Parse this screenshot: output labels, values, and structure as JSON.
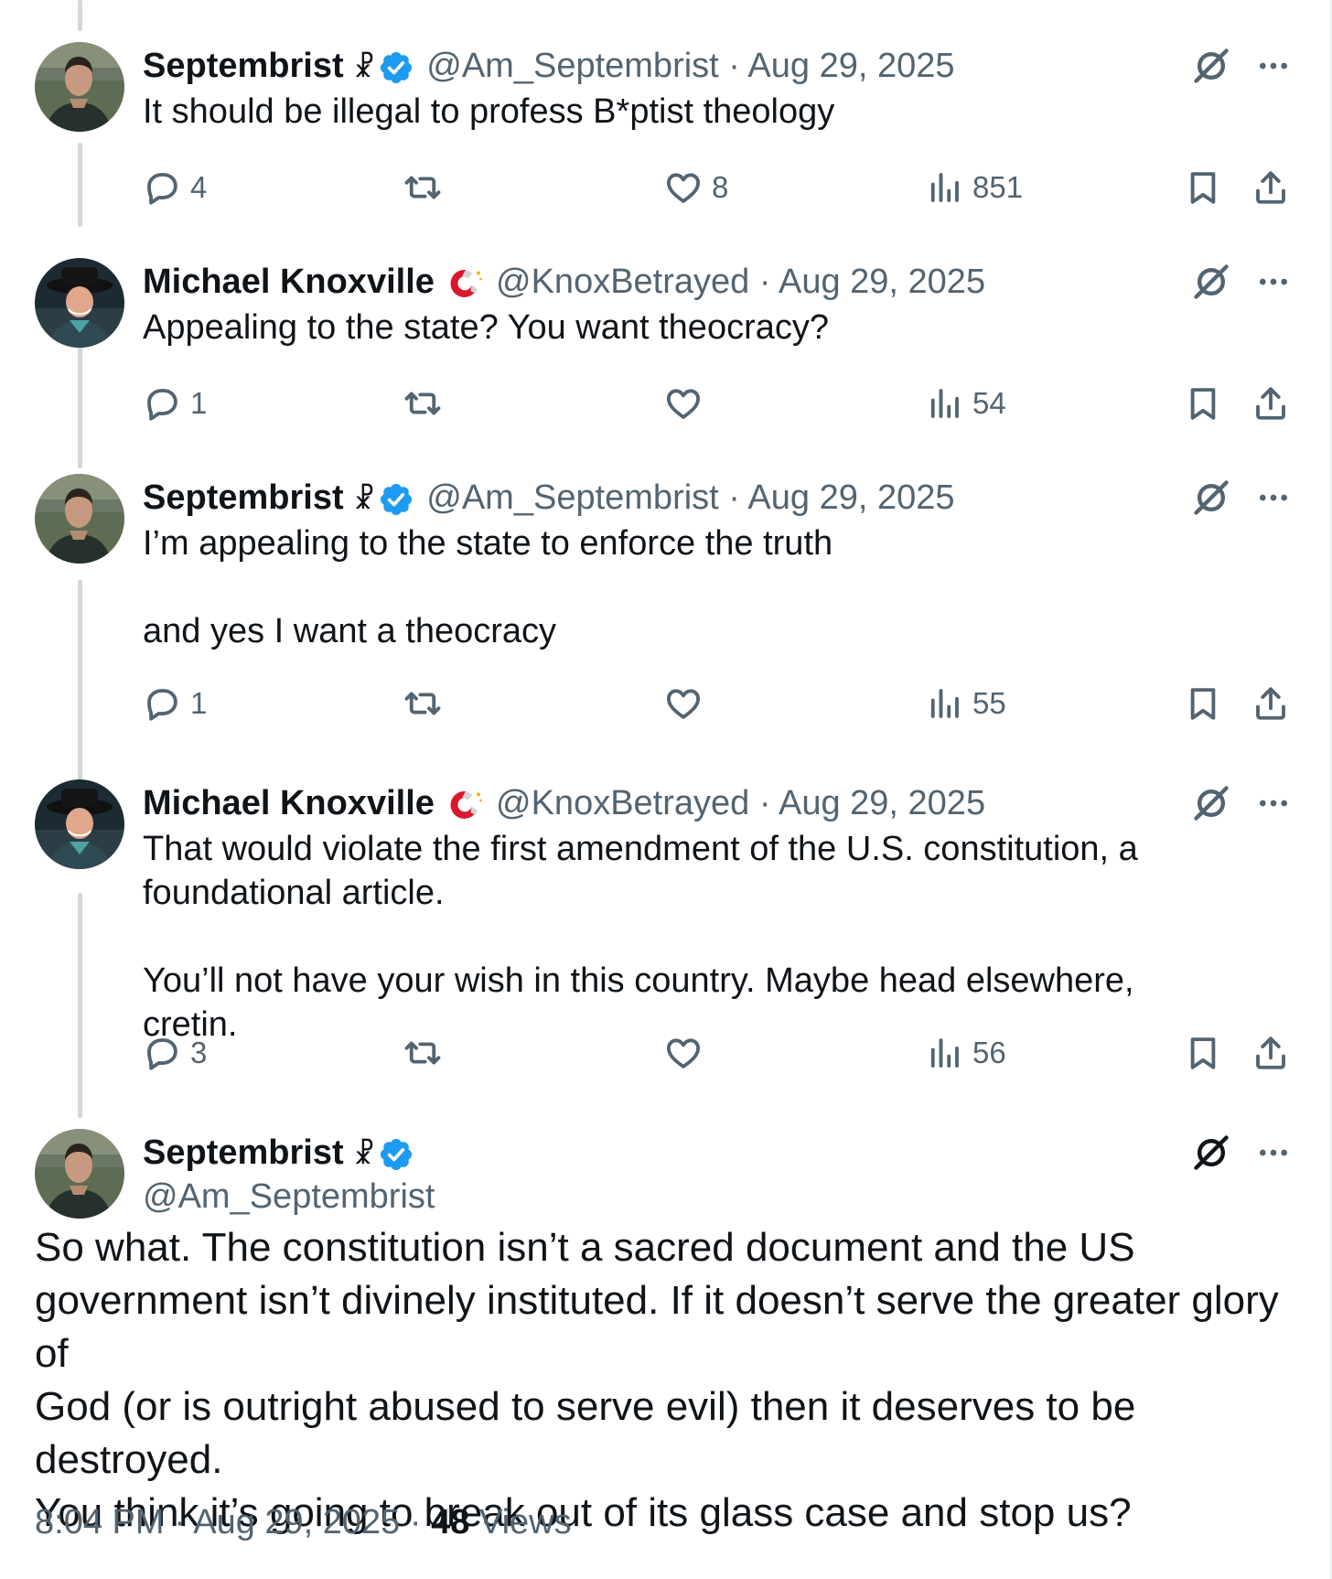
{
  "thread": [
    {
      "author": "Septembrist",
      "author_symbol": "☧",
      "verified": true,
      "handle": "@Am_Septembrist",
      "dot": "·",
      "date": "Aug 29, 2025",
      "text": "It should be illegal to profess B*ptist theology",
      "replies": "4",
      "reposts": "",
      "likes": "8",
      "views": "851",
      "avatar": "man-dark-jacket"
    },
    {
      "author": "Michael Knoxville",
      "author_symbol": "magnet",
      "verified": false,
      "handle": "@KnoxBetrayed",
      "dot": "·",
      "date": "Aug 29, 2025",
      "text": "Appealing to the state? You want theocracy?",
      "replies": "1",
      "reposts": "",
      "likes": "",
      "views": "54",
      "avatar": "man-black-hat"
    },
    {
      "author": "Septembrist",
      "author_symbol": "☧",
      "verified": true,
      "handle": "@Am_Septembrist",
      "dot": "·",
      "date": "Aug 29, 2025",
      "text": "I’m appealing to the state to enforce the truth\n\nand yes I want a theocracy",
      "replies": "1",
      "reposts": "",
      "likes": "",
      "views": "55",
      "avatar": "man-dark-jacket"
    },
    {
      "author": "Michael Knoxville",
      "author_symbol": "magnet",
      "verified": false,
      "handle": "@KnoxBetrayed",
      "dot": "·",
      "date": "Aug 29, 2025",
      "text": "That would violate the first amendment of the U.S. constitution, a\nfoundational article.\n\nYou’ll not have your wish in this country. Maybe head elsewhere, cretin.",
      "replies": "3",
      "reposts": "",
      "likes": "",
      "views": "56",
      "avatar": "man-black-hat"
    }
  ],
  "main_tweet": {
    "author": "Septembrist",
    "author_symbol": "☧",
    "verified": true,
    "handle": "@Am_Septembrist",
    "text": "So what. The constitution isn’t a sacred document and the US\ngovernment isn’t divinely instituted. If it doesn’t serve the greater glory of\nGod (or is outright abused to serve evil) then it deserves to be destroyed.\nYou think it’s going to break out of its glass case and stop us?",
    "time": "8:04 PM",
    "dot1": "·",
    "date": "Aug 29, 2025",
    "dot2": "·",
    "views_count": "48",
    "views_label": "Views"
  },
  "colors": {
    "text": "#0f1419",
    "muted": "#536471",
    "verified_blue": "#1d9bf0",
    "thread_line": "#cfd9de"
  },
  "icons": [
    "reply-icon",
    "repost-icon",
    "like-icon",
    "views-icon",
    "bookmark-icon",
    "share-icon",
    "grok-icon",
    "more-icon",
    "verified-badge-icon",
    "magnet-icon"
  ]
}
